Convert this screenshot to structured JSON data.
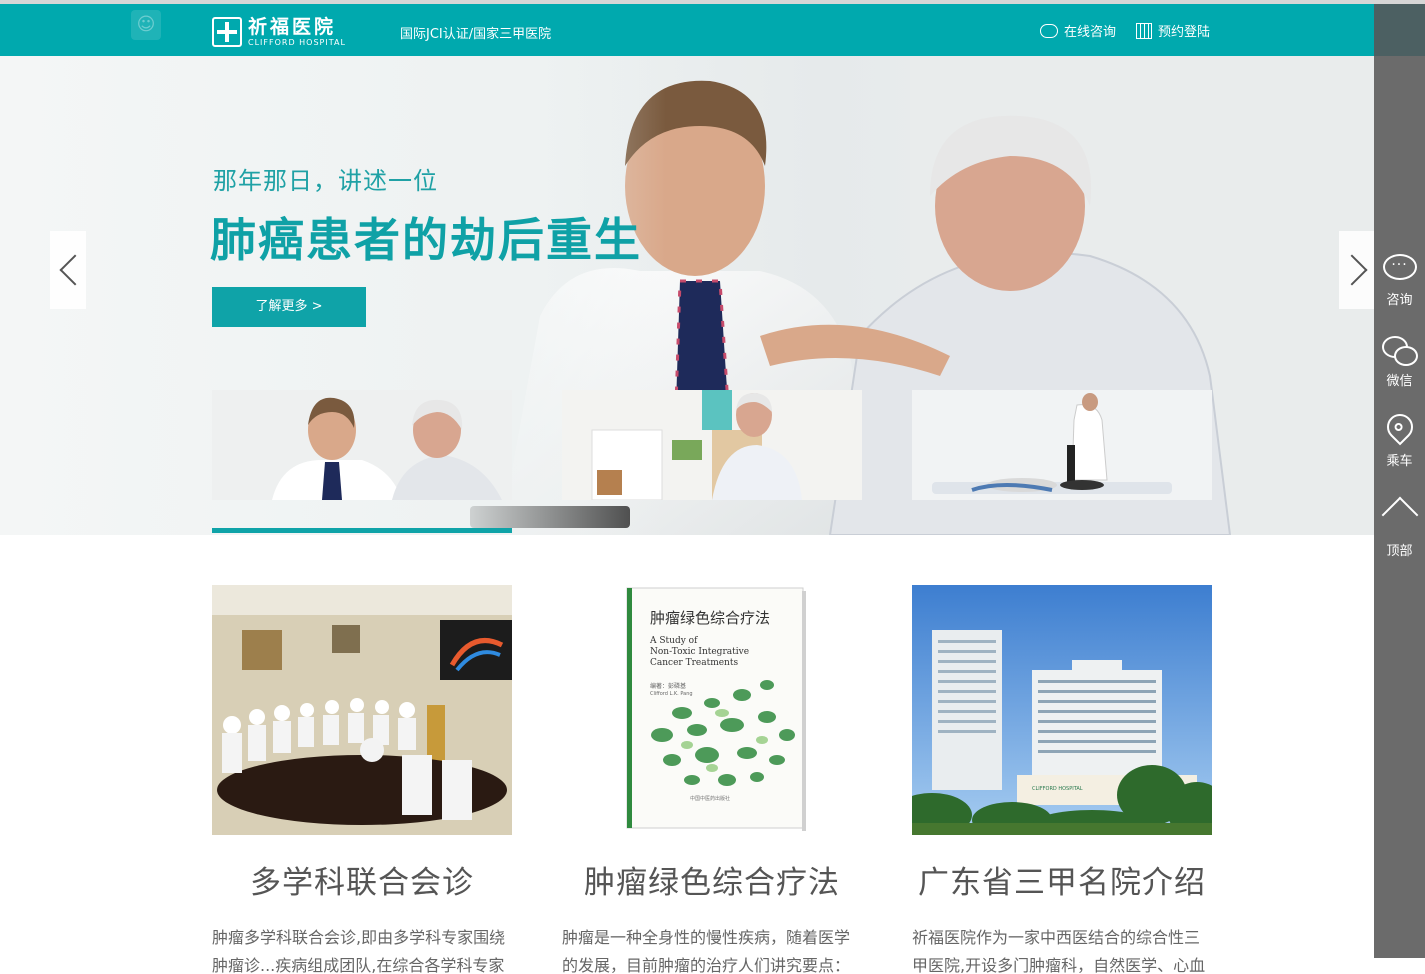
{
  "header": {
    "logo_cn": "祈福医院",
    "logo_en": "CLIFFORD HOSPITAL",
    "tagline": "国际JCI认证/国家三甲医院",
    "online_consult": "在线咨询",
    "appointment": "预约登陆"
  },
  "banner": {
    "subtitle": "那年那日，讲述一位",
    "title": "肺癌患者的劫后重生",
    "button": "了解更多 >"
  },
  "sidebar": {
    "items": [
      {
        "label": "咨询",
        "icon": "chat-bubble-icon"
      },
      {
        "label": "微信",
        "icon": "wechat-icon"
      },
      {
        "label": "乘车",
        "icon": "location-pin-icon"
      },
      {
        "label": "顶部",
        "icon": "arrow-up-icon"
      }
    ]
  },
  "cards": [
    {
      "title": "多学科联合会诊",
      "text": "肿瘤多学科联合会诊,即由多学科专家围绕肿瘤诊...疾病组成团队,在综合各学科专家"
    },
    {
      "title": "肿瘤绿色综合疗法",
      "text": "肿瘤是一种全身性的慢性疾病，随着医学的发展，目前肿瘤的治疗人们讲究要点："
    },
    {
      "title": "广东省三甲名院介绍",
      "text": "祈福医院作为一家中西医结合的综合性三甲医院,开设多门肿瘤科，自然医学、心血"
    }
  ],
  "book": {
    "title_cn": "肿瘤绿色综合疗法",
    "title_en": "A Study of Non-Toxic Integrative Cancer Treatments",
    "author": "编著：彭磷基",
    "author_en": "Clifford L.K. Pang",
    "publisher": "中国中医药出版社"
  },
  "building_sign": "CLIFFORD HOSPITAL",
  "colors": {
    "teal": "#00a9ae",
    "sidebar": "#6b6b6b",
    "sidebar_top": "#4c6062"
  }
}
